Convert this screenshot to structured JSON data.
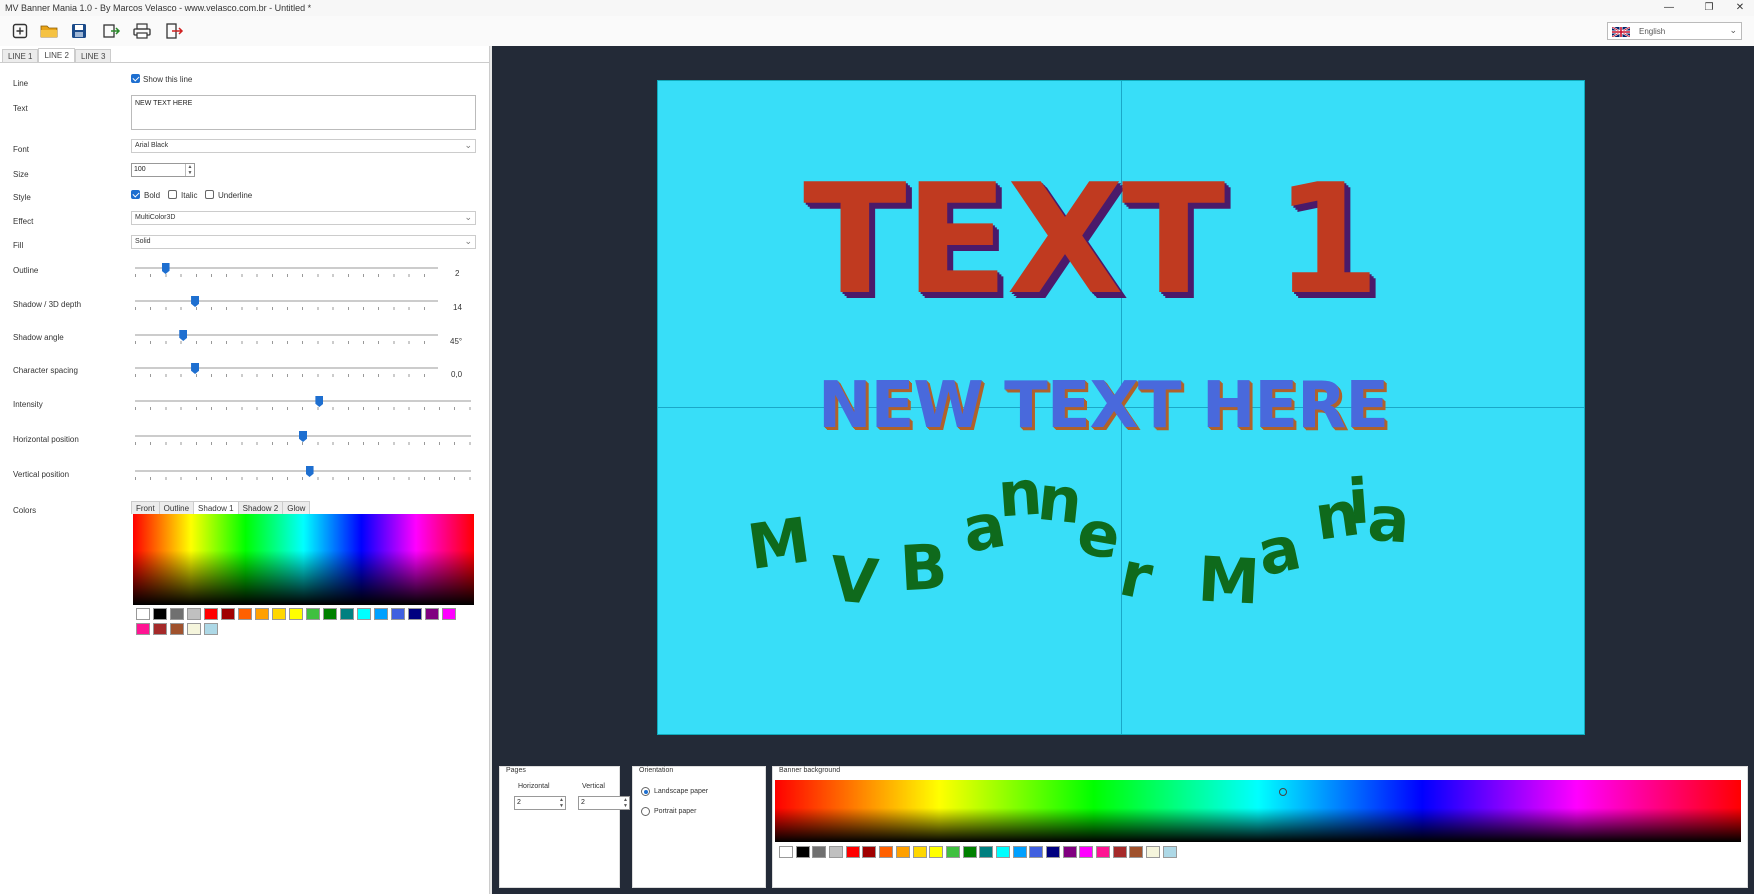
{
  "window": {
    "title": "MV Banner Mania 1.0 - By Marcos Velasco - www.velasco.com.br - Untitled *",
    "minimize": "—",
    "maximize": "❐",
    "close": "✕"
  },
  "toolbar": {
    "icons": [
      "new-icon",
      "open-folder-icon",
      "save-icon",
      "export-icon",
      "print-icon",
      "exit-icon"
    ],
    "language": "English"
  },
  "line_tabs": [
    "LINE 1",
    "LINE 2",
    "LINE 3"
  ],
  "form": {
    "line_label": "Line",
    "show_line": "Show this line",
    "text_label": "Text",
    "text_value": "NEW TEXT HERE",
    "font_label": "Font",
    "font_value": "Arial Black",
    "size_label": "Size",
    "size_value": "100",
    "style_label": "Style",
    "bold": "Bold",
    "italic": "Italic",
    "underline": "Underline",
    "effect_label": "Effect",
    "effect_value": "MultiColor3D",
    "fill_label": "Fill",
    "fill_value": "Solid",
    "outline_label": "Outline",
    "outline_value": "2",
    "shadow_label": "Shadow / 3D depth",
    "shadow_value": "14",
    "angle_label": "Shadow angle",
    "angle_value": "45°",
    "spacing_label": "Character spacing",
    "spacing_value": "0,0",
    "intensity_label": "Intensity",
    "hpos_label": "Horizontal position",
    "vpos_label": "Vertical position",
    "colors_label": "Colors"
  },
  "slider_levels": {
    "outline": 0.09,
    "shadow": 0.19,
    "angle": 0.15,
    "spacing": 0.19,
    "intensity": 0.55,
    "hpos": 0.5,
    "vpos": 0.52
  },
  "color_tabs": [
    "Front",
    "Outline",
    "Shadow 1",
    "Shadow 2",
    "Glow"
  ],
  "palette": [
    "#ffffff",
    "#000000",
    "#707070",
    "#c0c0c0",
    "#ff0000",
    "#a00000",
    "#ff6000",
    "#ffa000",
    "#ffd700",
    "#ffff00",
    "#40c040",
    "#008000",
    "#008080",
    "#00ffff",
    "#00a0ff",
    "#4060e0",
    "#000080",
    "#800080",
    "#ff00ff",
    "#ff1493",
    "#a52a2a",
    "#a0522d",
    "#f5f5dc",
    "#add8e6"
  ],
  "banner": {
    "line1": "TEXT 1",
    "line2": "NEW TEXT HERE",
    "line3_letters": [
      "M",
      "V",
      "B",
      "a",
      "n",
      "n",
      "e",
      "r",
      "M",
      "a",
      "n",
      "i",
      "a"
    ],
    "background": "#38def8"
  },
  "bottom": {
    "pages_title": "Pages",
    "horizontal_label": "Horizontal",
    "vertical_label": "Vertical",
    "horizontal_value": "2",
    "vertical_value": "2",
    "orientation_title": "Orientation",
    "landscape": "Landscape paper",
    "portrait": "Portrait paper",
    "bg_title": "Banner background"
  },
  "bottom_palette": [
    "#ffffff",
    "#000000",
    "#707070",
    "#c0c0c0",
    "#ff0000",
    "#a00000",
    "#ff6000",
    "#ffa000",
    "#ffd700",
    "#ffff00",
    "#40c040",
    "#008000",
    "#008080",
    "#00ffff",
    "#00a0ff",
    "#4060e0",
    "#000080",
    "#800080",
    "#ff00ff",
    "#ff1493",
    "#a52a2a",
    "#a0522d",
    "#f5f5dc",
    "#add8e6"
  ]
}
